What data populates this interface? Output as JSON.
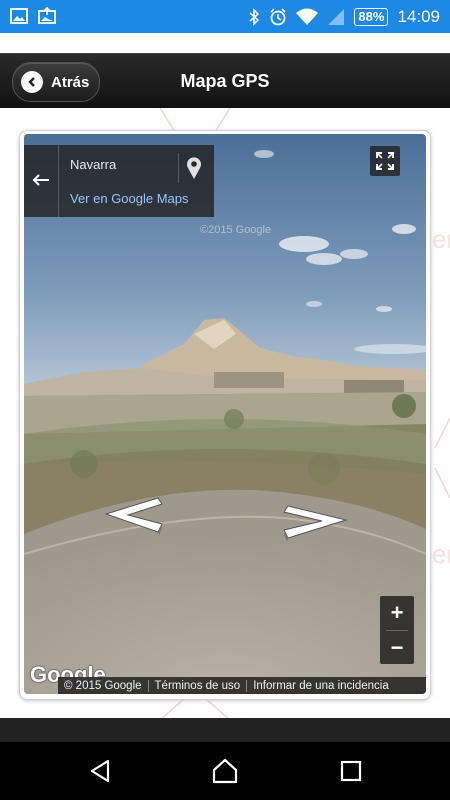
{
  "status_bar": {
    "battery": "88%",
    "time": "14:09",
    "color": "#1e88e5"
  },
  "header": {
    "back_label": "Atrás",
    "title": "Mapa GPS"
  },
  "street_view": {
    "location": "Navarra",
    "open_in_maps": "Ver en Google Maps",
    "watermark": "©2015 Google",
    "logo": "Google",
    "zoom_in": "+",
    "zoom_out": "−",
    "footer": {
      "copyright": "© 2015 Google",
      "terms": "Términos de uso",
      "report": "Informar de una incidencia"
    }
  }
}
